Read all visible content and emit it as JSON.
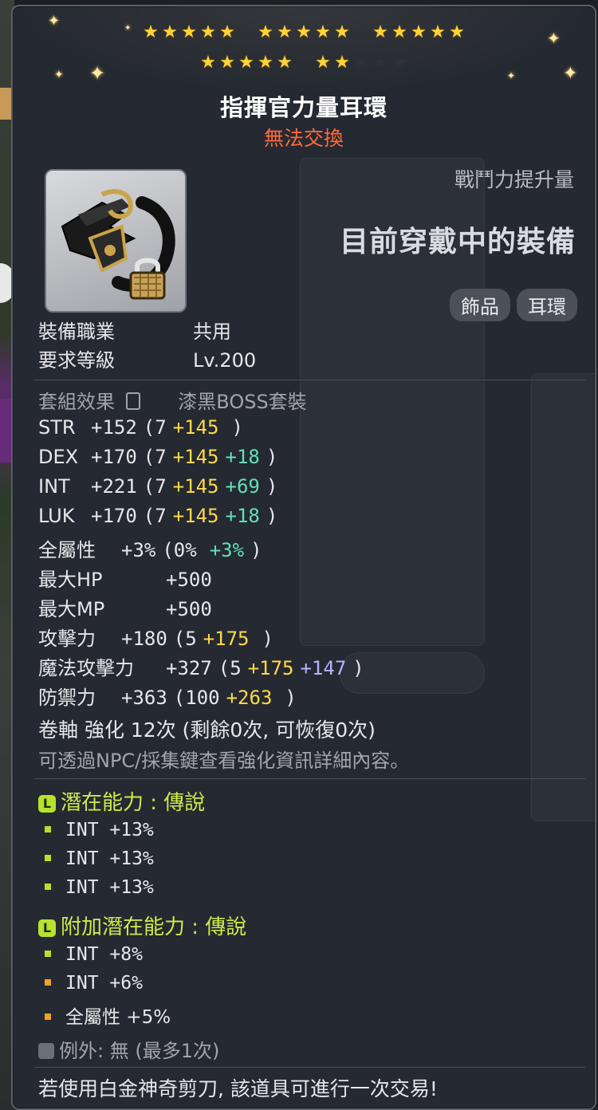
{
  "stars": {
    "filled": 22,
    "total": 25
  },
  "item": {
    "name": "指揮官力量耳環",
    "trade_status": "無法交換",
    "power_label": "戰鬥力提升量",
    "equipped_label": "目前穿戴中的裝備",
    "tags": [
      "飾品",
      "耳環"
    ]
  },
  "info": {
    "job_label": "裝備職業",
    "job_value": "共用",
    "level_label": "要求等級",
    "level_value": "Lv.200",
    "set_label": "套組效果",
    "set_value": "漆黑BOSS套裝"
  },
  "stats": [
    {
      "label": "STR",
      "total": "+152",
      "open": "(7",
      "bonus": "+145",
      "extra": "",
      "extra_color": "",
      "close": ")"
    },
    {
      "label": "DEX",
      "total": "+170",
      "open": "(7",
      "bonus": "+145",
      "extra": "+18",
      "extra_color": "g",
      "close": ")"
    },
    {
      "label": "INT",
      "total": "+221",
      "open": "(7",
      "bonus": "+145",
      "extra": "+69",
      "extra_color": "g",
      "close": ")"
    },
    {
      "label": "LUK",
      "total": "+170",
      "open": "(7",
      "bonus": "+145",
      "extra": "+18",
      "extra_color": "g",
      "close": ")"
    },
    {
      "label": "全屬性",
      "total": "+3%",
      "open": "(0%",
      "bonus": "",
      "extra": "+3%",
      "extra_color": "g",
      "close": ")"
    },
    {
      "label": "最大HP",
      "total": "+500",
      "open": "",
      "bonus": "",
      "extra": "",
      "extra_color": "",
      "close": ""
    },
    {
      "label": "最大MP",
      "total": "+500",
      "open": "",
      "bonus": "",
      "extra": "",
      "extra_color": "",
      "close": ""
    },
    {
      "label": "攻擊力",
      "total": "+180",
      "open": "(5",
      "bonus": "+175",
      "extra": "",
      "extra_color": "",
      "close": ")"
    },
    {
      "label": "魔法攻擊力",
      "total": "+327",
      "open": "(5",
      "bonus": "+175",
      "extra": "+147",
      "extra_color": "p",
      "close": ")"
    },
    {
      "label": "防禦力",
      "total": "+363",
      "open": "(100",
      "bonus": "+263",
      "extra": "",
      "extra_color": "",
      "close": ")"
    }
  ],
  "scroll": {
    "text": "卷軸 強化 12次 (剩餘0次, 可恢復0次)",
    "hint": "可透過NPC/採集鍵查看強化資訊詳細內容。"
  },
  "potential": {
    "title": "潛在能力 : 傳說",
    "icon": "L",
    "lines": [
      "INT +13%",
      "INT +13%",
      "INT +13%"
    ]
  },
  "additional_potential": {
    "title": "附加潛在能力 : 傳說",
    "icon": "L",
    "lines": [
      "INT +8%",
      "INT +6%",
      "全屬性 +5%"
    ]
  },
  "exception": "例外: 無 (最多1次)",
  "footer": "若使用白金神奇剪刀, 該道具可進行一次交易!",
  "colors": {
    "bonus": "#ffd94a",
    "green": "#5fe0b4",
    "purple": "#b8b2ff",
    "warning": "#ff6a3a",
    "potential": "#cfe94a"
  }
}
